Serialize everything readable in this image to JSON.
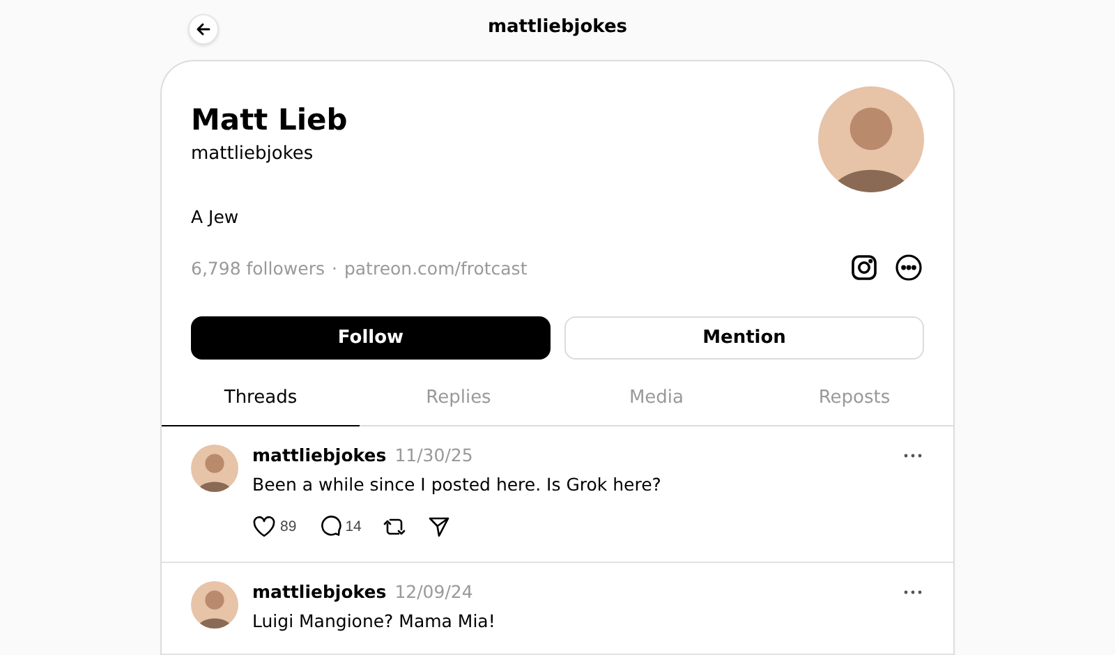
{
  "header": {
    "title": "mattliebjokes"
  },
  "profile": {
    "name": "Matt Lieb",
    "username": "mattliebjokes",
    "bio": "A Jew",
    "followers": "6,798 followers",
    "separator": "·",
    "link": "patreon.com/frotcast"
  },
  "buttons": [
    {
      "label": "Follow",
      "kind": "primary"
    },
    {
      "label": "Mention",
      "kind": "secondary"
    }
  ],
  "tabs": [
    {
      "label": "Threads",
      "selected": true
    },
    {
      "label": "Replies",
      "selected": false
    },
    {
      "label": "Media",
      "selected": false
    },
    {
      "label": "Reposts",
      "selected": false
    }
  ],
  "posts": [
    {
      "username": "mattliebjokes",
      "date": "11/30/25",
      "text": "Been a while since I posted here. Is Grok here?",
      "likes": "89",
      "replies": "14"
    },
    {
      "username": "mattliebjokes",
      "date": "12/09/24",
      "text": "Luigi Mangione? Mama Mia!"
    }
  ]
}
